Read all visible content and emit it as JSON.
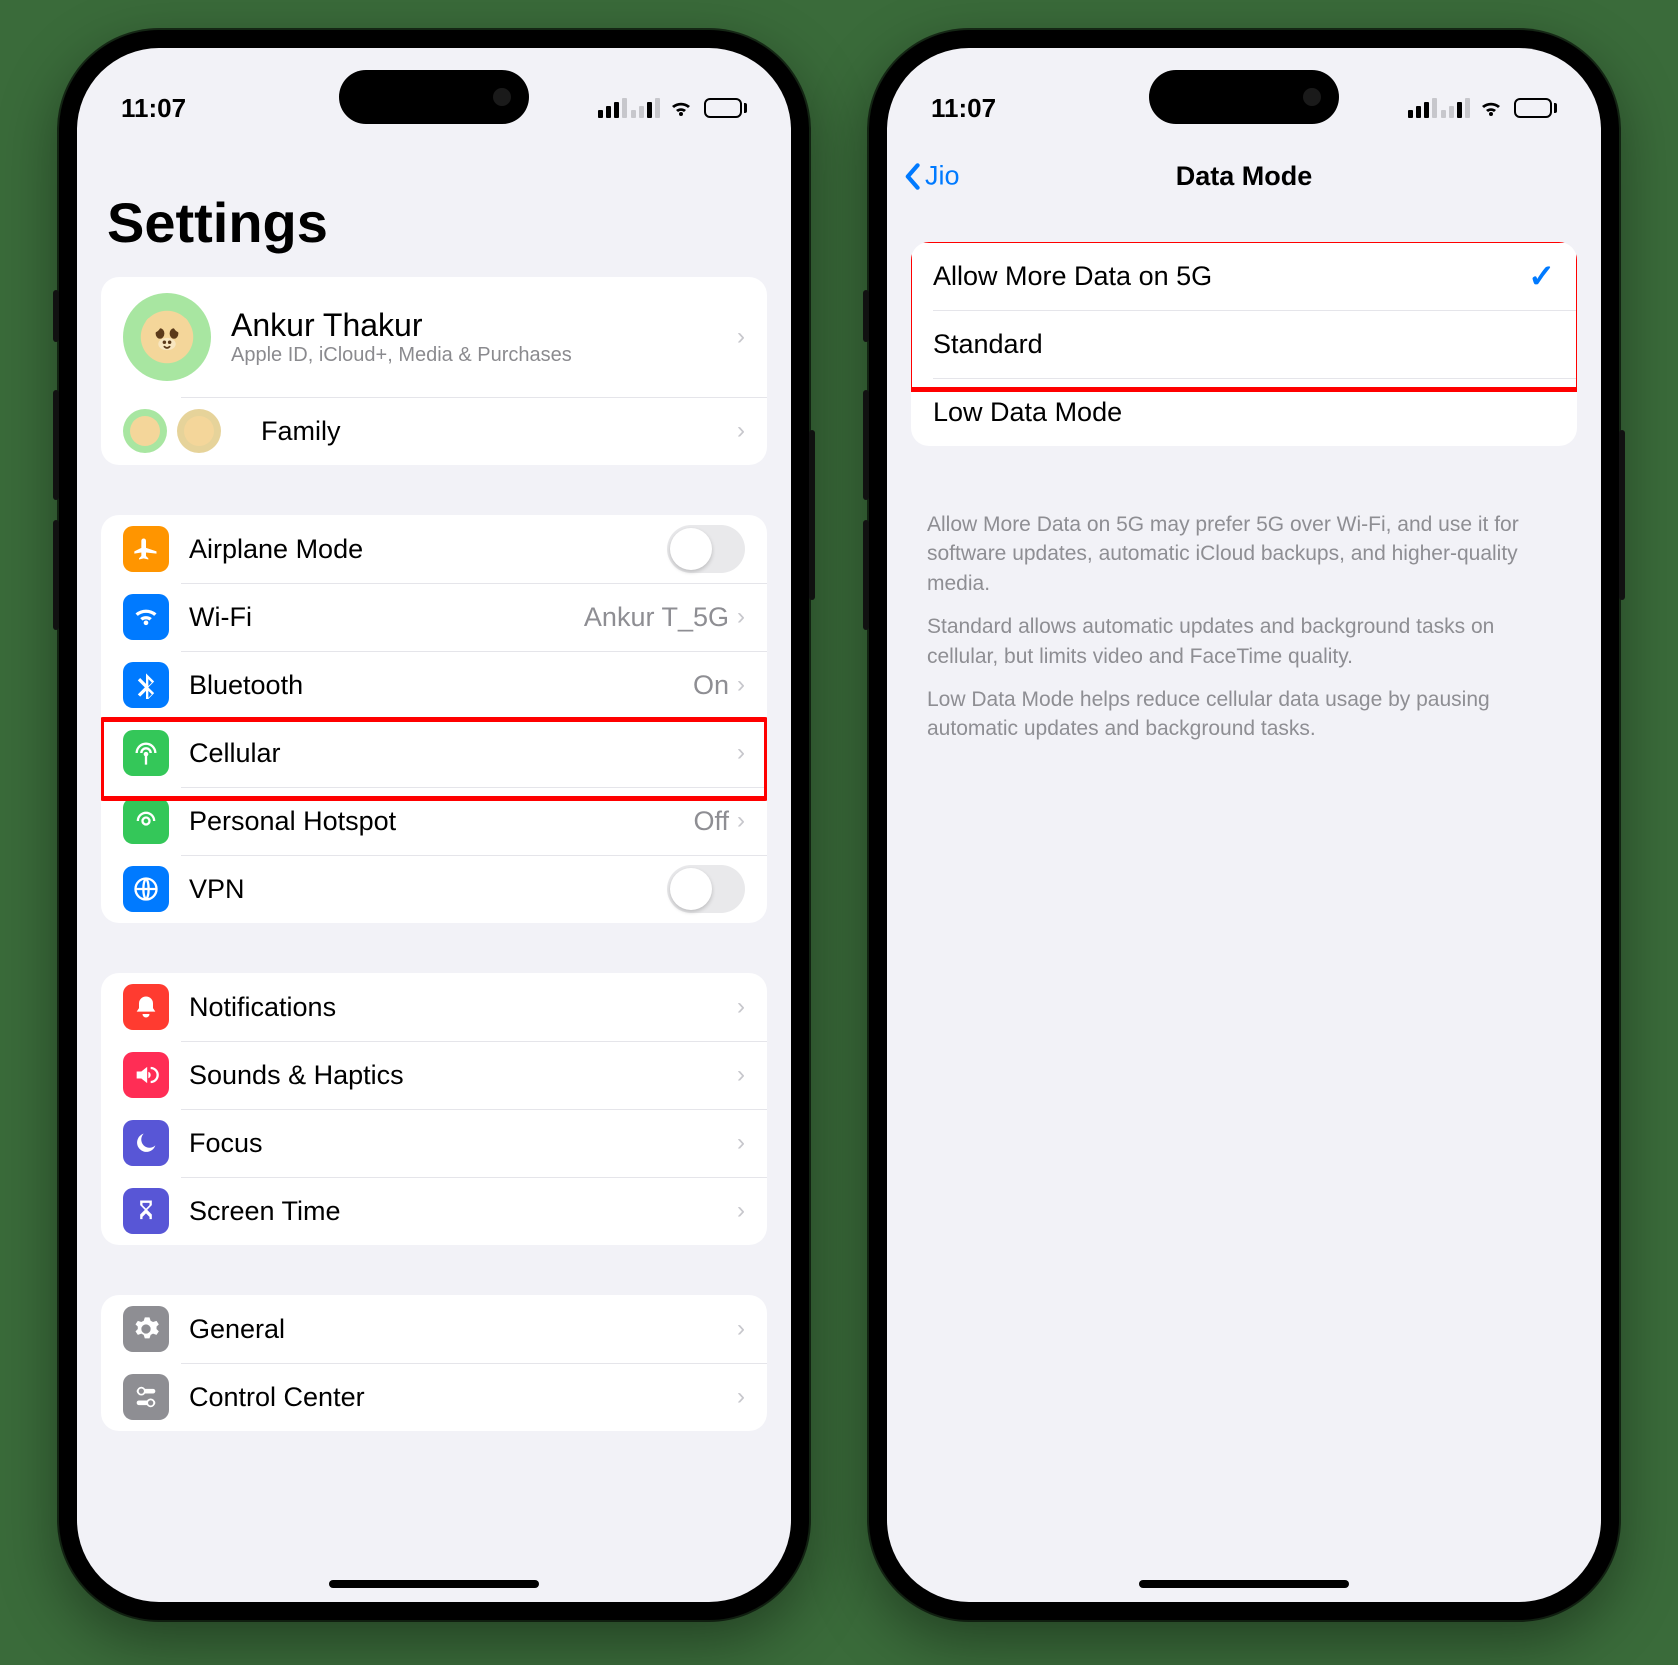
{
  "status": {
    "time": "11:07"
  },
  "left": {
    "title": "Settings",
    "profile": {
      "name": "Ankur Thakur",
      "sub": "Apple ID, iCloud+, Media & Purchases"
    },
    "family": "Family",
    "rows": {
      "airplane": "Airplane Mode",
      "wifi": "Wi-Fi",
      "wifi_val": "Ankur T_5G",
      "bluetooth": "Bluetooth",
      "bluetooth_val": "On",
      "cellular": "Cellular",
      "hotspot": "Personal Hotspot",
      "hotspot_val": "Off",
      "vpn": "VPN",
      "notifications": "Notifications",
      "sounds": "Sounds & Haptics",
      "focus": "Focus",
      "screentime": "Screen Time",
      "general": "General",
      "control_center": "Control Center"
    }
  },
  "right": {
    "back": "Jio",
    "title": "Data Mode",
    "opts": {
      "allow": "Allow More Data on 5G",
      "standard": "Standard",
      "low": "Low Data Mode"
    },
    "footer1": "Allow More Data on 5G may prefer 5G over Wi-Fi, and use it for software updates, automatic iCloud backups, and higher-quality media.",
    "footer2": "Standard allows automatic updates and background tasks on cellular, but limits video and FaceTime quality.",
    "footer3": "Low Data Mode helps reduce cellular data usage by pausing automatic updates and background tasks."
  }
}
